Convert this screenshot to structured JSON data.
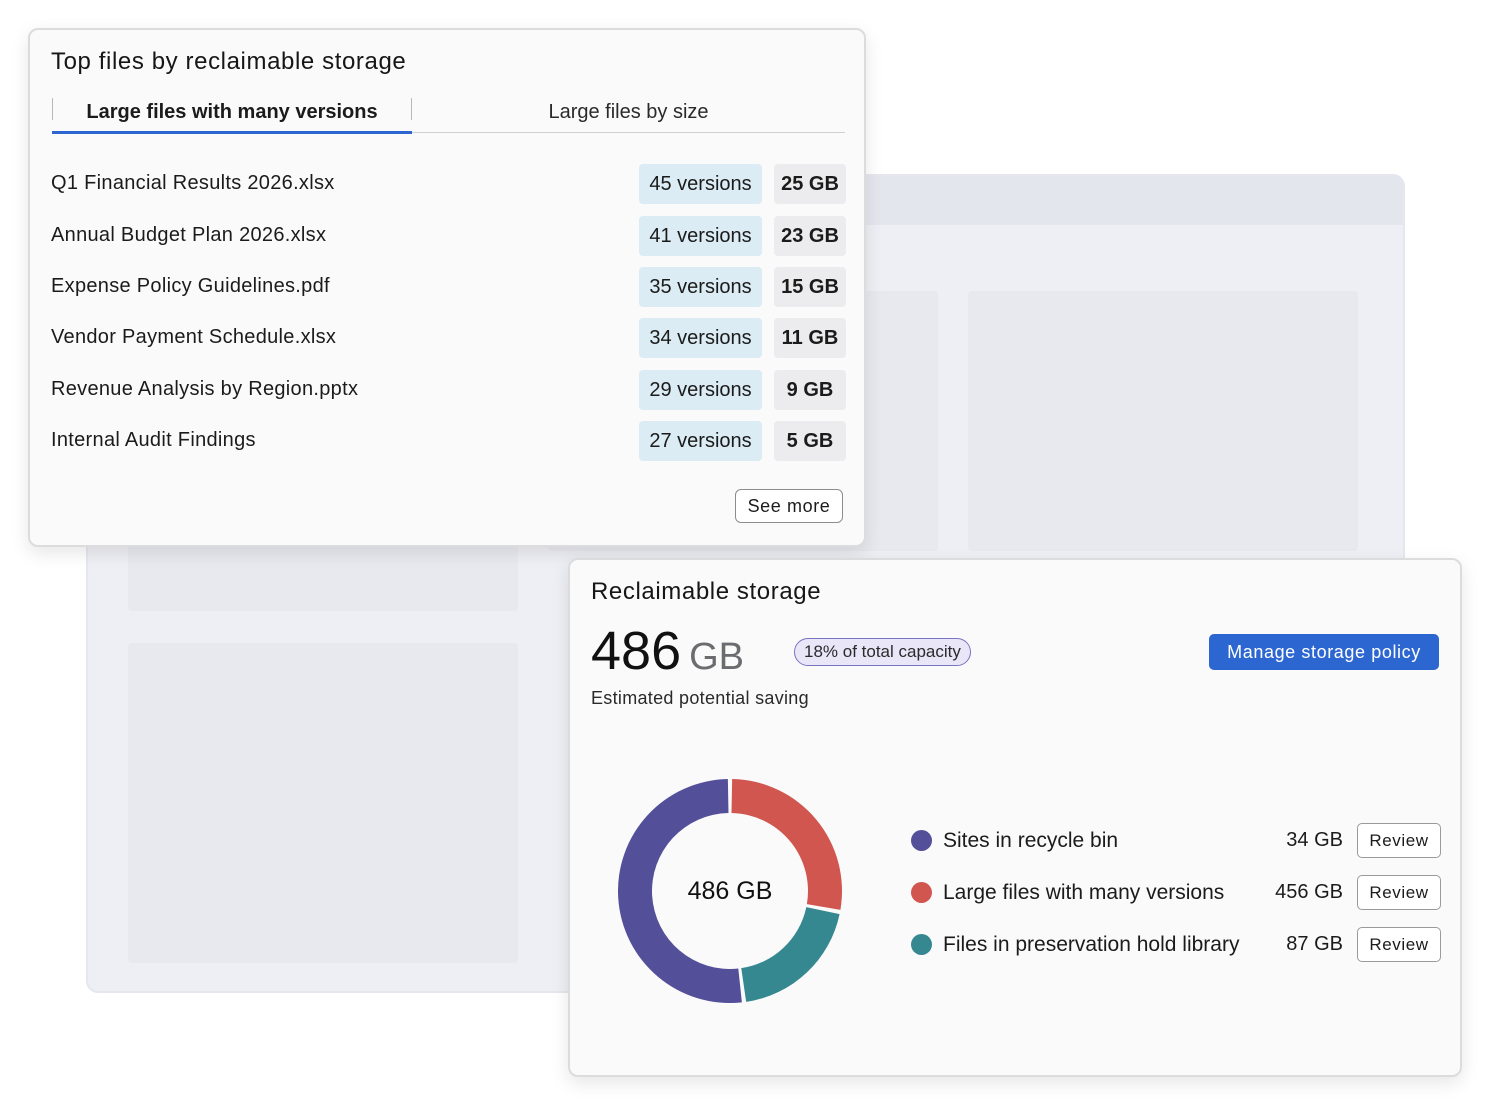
{
  "top_card": {
    "title": "Top files by reclaimable storage",
    "tabs": [
      {
        "label": "Large files with many versions",
        "active": true
      },
      {
        "label": "Large files by size",
        "active": false
      }
    ],
    "files": [
      {
        "name": "Q1 Financial Results 2026.xlsx",
        "versions": "45 versions",
        "size": "25 GB"
      },
      {
        "name": "Annual Budget Plan 2026.xlsx",
        "versions": "41 versions",
        "size": "23 GB"
      },
      {
        "name": "Expense Policy Guidelines.pdf",
        "versions": "35 versions",
        "size": "15 GB"
      },
      {
        "name": "Vendor Payment Schedule.xlsx",
        "versions": "34 versions",
        "size": "11 GB"
      },
      {
        "name": "Revenue Analysis by Region.pptx",
        "versions": "29 versions",
        "size": "9 GB"
      },
      {
        "name": "Internal Audit Findings",
        "versions": "27 versions",
        "size": "5 GB"
      }
    ],
    "see_more_label": "See more"
  },
  "bottom_card": {
    "title": "Reclaimable storage",
    "value": "486",
    "unit": "GB",
    "capacity_badge": "18% of total capacity",
    "manage_label": "Manage storage policy",
    "subtitle": "Estimated potential saving",
    "donut_center": "486 GB",
    "legend": [
      {
        "label": "Sites in recycle bin",
        "value": "34 GB",
        "color": "#534f99",
        "review_label": "Review"
      },
      {
        "label": "Large files with many versions",
        "value": "456 GB",
        "color": "#d0564f",
        "review_label": "Review"
      },
      {
        "label": "Files in preservation hold library",
        "value": "87 GB",
        "color": "#358890",
        "review_label": "Review"
      }
    ]
  },
  "chart_data": {
    "type": "pie",
    "categories": [
      "Sites in recycle bin",
      "Large files with many versions",
      "Files in preservation hold library"
    ],
    "values": [
      34,
      456,
      87
    ],
    "display_fractions": [
      0.52,
      0.28,
      0.2
    ],
    "colors": [
      "#534f99",
      "#d0564f",
      "#358890"
    ],
    "center_label": "486 GB"
  },
  "colors": {
    "accent": "#2c67d1",
    "version_badge": "#dcecf4",
    "size_badge": "#ececee"
  }
}
